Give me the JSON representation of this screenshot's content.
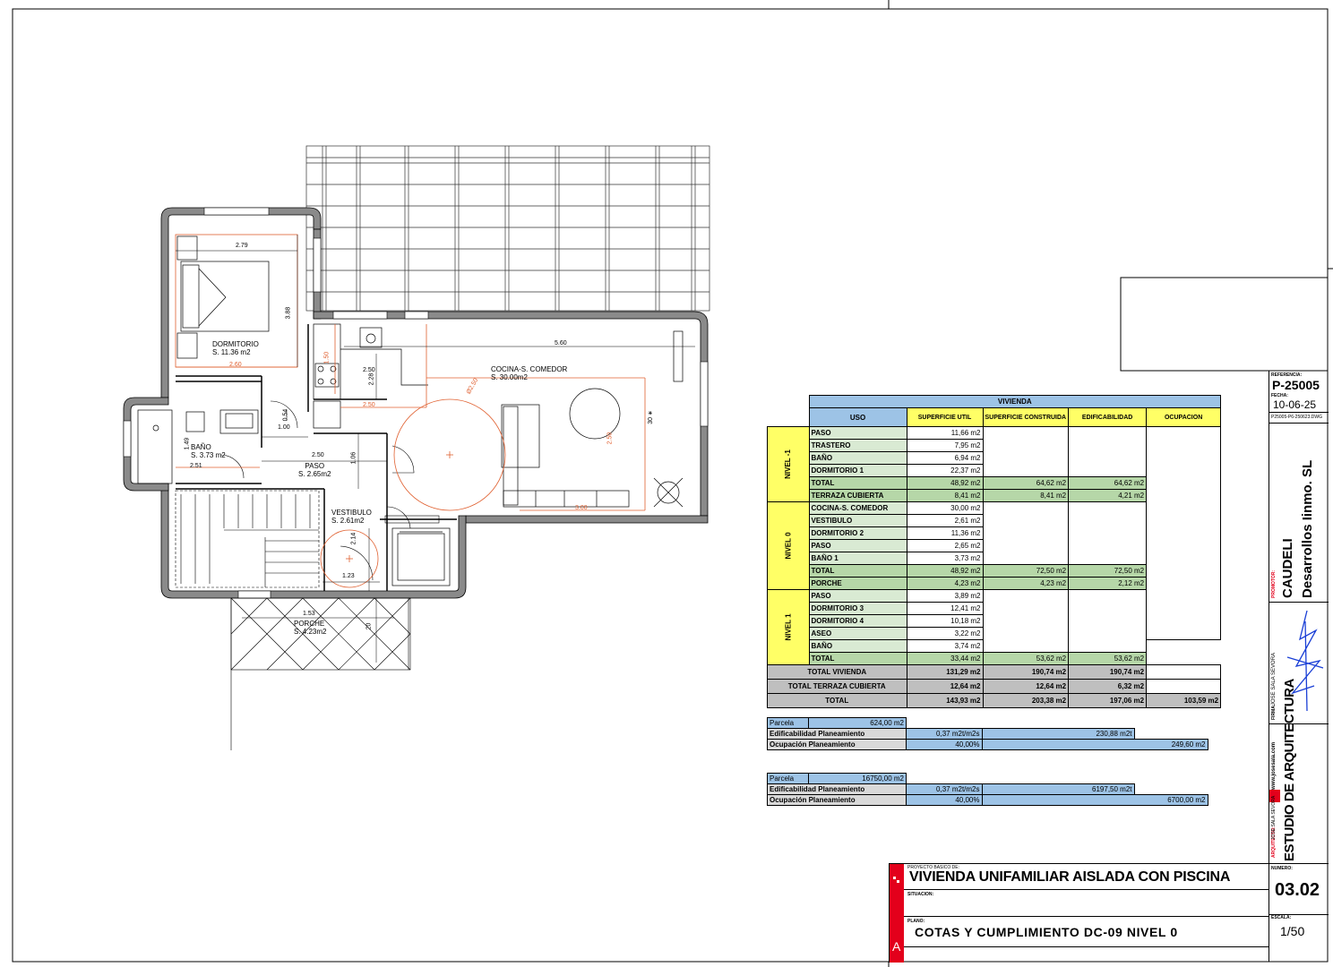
{
  "plan": {
    "rooms": [
      {
        "name": "DORMITORIO",
        "area": "S. 11.36 m2"
      },
      {
        "name": "BAÑO",
        "area": "S. 3.73 m2"
      },
      {
        "name": "PASO",
        "area": "S. 2.65m2"
      },
      {
        "name": "VESTIBULO",
        "area": "S. 2.61m2"
      },
      {
        "name": "COCINA-S. COMEDOR",
        "area": "S. 30.00m2"
      },
      {
        "name": "PORCHE",
        "area": "S. 4.23m2"
      }
    ],
    "dims": [
      "2.79",
      "3.88",
      "2.60",
      "0.54",
      "1.00",
      "1.49",
      "2.51",
      "2.50",
      "1.06",
      "2.50",
      "2.28",
      "2.50",
      "5.60",
      "Ø2.50",
      "2.50",
      "3.00",
      "30 ∗",
      "2.14",
      "1.23",
      "1.53",
      "20",
      "1.50"
    ]
  },
  "table": {
    "title": "VIVIENDA",
    "headers": [
      "USO",
      "SUPERFICIE UTIL",
      "SUPERFICIE CONSTRUIDA",
      "EDIFICABILIDAD",
      "OCUPACION"
    ],
    "levels": [
      {
        "name": "NIVEL -1",
        "rows": [
          {
            "uso": "PASO",
            "util": "11,66 m2"
          },
          {
            "uso": "TRASTERO",
            "util": "7,95 m2"
          },
          {
            "uso": "BAÑO",
            "util": "6,94 m2"
          },
          {
            "uso": "DORMITORIO 1",
            "util": "22,37 m2"
          }
        ],
        "total": {
          "uso": "TOTAL",
          "util": "48,92 m2",
          "cons": "64,62 m2",
          "edif": "64,62 m2"
        },
        "extra": {
          "uso": "TERRAZA CUBIERTA",
          "util": "8,41 m2",
          "cons": "8,41 m2",
          "edif": "4,21 m2"
        }
      },
      {
        "name": "NIVEL 0",
        "rows": [
          {
            "uso": "COCINA-S. COMEDOR",
            "util": "30,00 m2"
          },
          {
            "uso": "VESTIBULO",
            "util": "2,61 m2"
          },
          {
            "uso": "DORMITORIO 2",
            "util": "11,36 m2"
          },
          {
            "uso": "PASO",
            "util": "2,65 m2"
          },
          {
            "uso": "BAÑO 1",
            "util": "3,73 m2"
          }
        ],
        "total": {
          "uso": "TOTAL",
          "util": "48,92 m2",
          "cons": "72,50 m2",
          "edif": "72,50 m2"
        },
        "extra": {
          "uso": "PORCHE",
          "util": "4,23 m2",
          "cons": "4,23 m2",
          "edif": "2,12 m2"
        }
      },
      {
        "name": "NIVEL 1",
        "rows": [
          {
            "uso": "PASO",
            "util": "3,89 m2"
          },
          {
            "uso": "DORMITORIO 3",
            "util": "12,41 m2"
          },
          {
            "uso": "DORMITORIO 4",
            "util": "10,18 m2"
          },
          {
            "uso": "ASEO",
            "util": "3,22 m2"
          },
          {
            "uso": "BAÑO",
            "util": "3,74 m2"
          }
        ],
        "total": {
          "uso": "TOTAL",
          "util": "33,44 m2",
          "cons": "53,62 m2",
          "edif": "53,62 m2"
        }
      }
    ],
    "totals": [
      {
        "label": "TOTAL VIVIENDA",
        "util": "131,29 m2",
        "cons": "190,74 m2",
        "edif": "190,74 m2",
        "ocup": ""
      },
      {
        "label": "TOTAL TERRAZA CUBIERTA",
        "util": "12,64 m2",
        "cons": "12,64 m2",
        "edif": "6,32 m2",
        "ocup": ""
      },
      {
        "label": "TOTAL",
        "util": "143,93 m2",
        "cons": "203,38 m2",
        "edif": "197,06 m2",
        "ocup": "103,59 m2"
      }
    ]
  },
  "planning": [
    {
      "parcela_label": "Parcela",
      "parcela": "624,00 m2",
      "edif_label": "Edificabilidad Planeamiento",
      "edif_coef": "0,37 m2t/m2s",
      "edif_val": "230,88 m2t",
      "ocup_label": "Ocupación Planeamiento",
      "ocup_pct": "40,00%",
      "ocup_val": "249,60 m2"
    },
    {
      "parcela_label": "Parcela",
      "parcela": "16750,00 m2",
      "edif_label": "Edificabilidad Planeamiento",
      "edif_coef": "0,37 m2t/m2s",
      "edif_val": "6197,50 m2t",
      "ocup_label": "Ocupación Planeamiento",
      "ocup_pct": "40,00%",
      "ocup_val": "6700,00 m2"
    }
  ],
  "titleblock": {
    "referencia_label": "REFERENCIA:",
    "referencia": "P-25005",
    "fecha_label": "FECHA:",
    "fecha": "10-06-25",
    "file": "P25005-P6-250623.DWG",
    "promotor_label": "PROMOTOR:",
    "promotor1": "CAUDELI",
    "promotor2": "Desarrollos Iinmo. SL",
    "firma_label": "FIRMA:",
    "firma": "JOSE SALA SEVORA",
    "web": "www.josesala.com",
    "estudio": "ESTUDIO DE ARQUITECTURA",
    "arquitecto_label": "ARQUITECTO:",
    "arquitecto": "JOSE SALA SEVORA",
    "proyecto_label": "PROYECTO BASICO DE:",
    "proyecto": "VIVIENDA UNIFAMILIAR AISLADA CON PISCINA",
    "situacion_label": "SITUACION:",
    "plano_label": "PLANO:",
    "plano": "COTAS Y CUMPLIMIENTO DC-09 NIVEL 0",
    "numero_label": "NUMERO:",
    "numero": "03.02",
    "escala_label": "ESCALA:",
    "escala": "1/50",
    "logo_letter": "A",
    "accent": "#e3001b"
  }
}
